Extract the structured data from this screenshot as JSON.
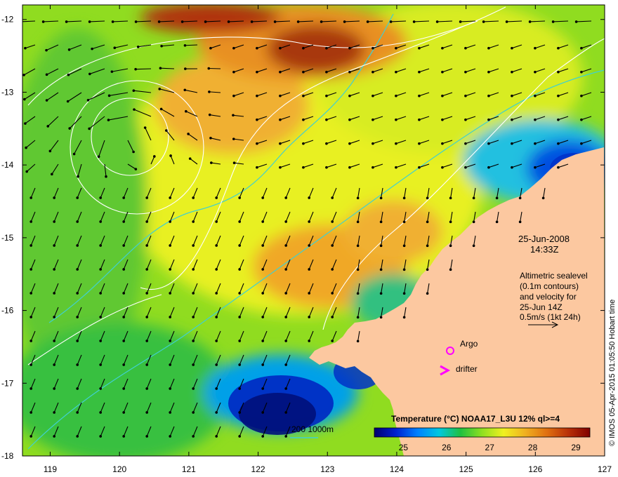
{
  "map": {
    "lat_ticks": [
      "-12",
      "-13",
      "-14",
      "-15",
      "-16",
      "-17",
      "-18"
    ],
    "lon_ticks": [
      "119",
      "120",
      "121",
      "122",
      "123",
      "124",
      "125",
      "126",
      "127"
    ],
    "lat_range": [
      -18,
      -11.8
    ],
    "lon_range": [
      118.6,
      127
    ]
  },
  "annotation": {
    "date": "25-Jun-2008",
    "time": "14:33Z",
    "alt_line1": "Altimetric sealevel",
    "alt_line2": "(0.1m contours)",
    "alt_line3": "and velocity for",
    "alt_line4": "25-Jun 14Z",
    "alt_line5": "0.5m/s (1kt 24h)"
  },
  "legend": {
    "title": "Temperature (°C) NOAA17_L3U 12% ql>=4",
    "ticks": [
      "25",
      "26",
      "27",
      "28",
      "29"
    ],
    "range": [
      24,
      29
    ],
    "colors": [
      "#00006e",
      "#0020d0",
      "#0080ff",
      "#00c8e0",
      "#20c040",
      "#90e020",
      "#f0f020",
      "#f0b020",
      "#e07010",
      "#b83008",
      "#800000"
    ],
    "isobath_label": "200  1000m"
  },
  "markers": {
    "argo_label": "Argo",
    "drifter_label": "drifter",
    "marker_color": "#ff00ff"
  },
  "credit": "© IMOS 05-Apr-2015 01:05:50 Hobart time",
  "colors": {
    "land": "#fcc8a0",
    "frame": "#000000",
    "contour": "#ffffff",
    "isobath": "#40d0d0"
  }
}
